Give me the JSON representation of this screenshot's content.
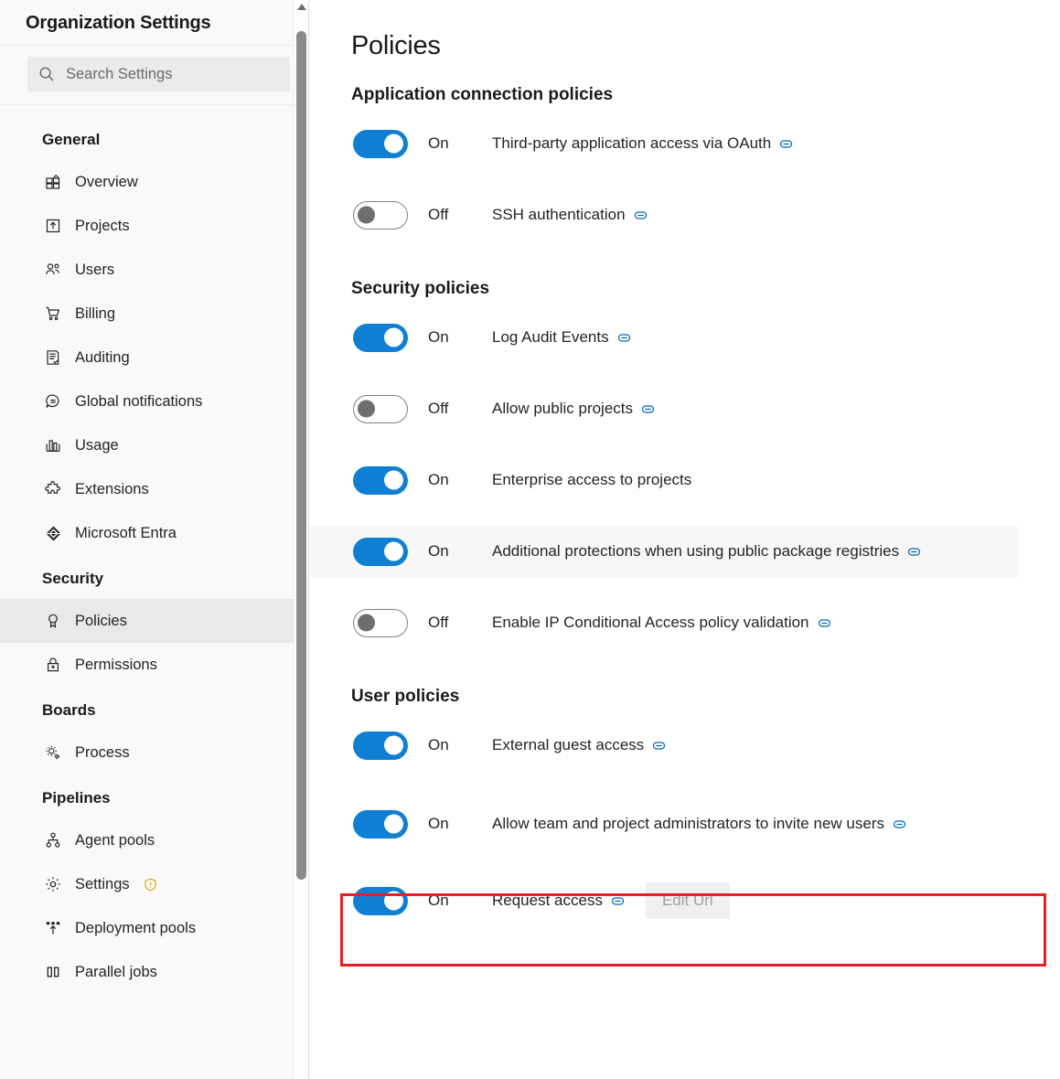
{
  "sidebar": {
    "title": "Organization Settings",
    "search": {
      "placeholder": "Search Settings",
      "value": "",
      "icon": "search-icon"
    },
    "groups": [
      {
        "label": "General",
        "items": [
          {
            "label": "Overview",
            "icon": "overview-icon",
            "active": false
          },
          {
            "label": "Projects",
            "icon": "projects-icon",
            "active": false
          },
          {
            "label": "Users",
            "icon": "users-icon",
            "active": false
          },
          {
            "label": "Billing",
            "icon": "billing-cart-icon",
            "active": false
          },
          {
            "label": "Auditing",
            "icon": "auditing-icon",
            "active": false
          },
          {
            "label": "Global notifications",
            "icon": "notification-bubble-icon",
            "active": false
          },
          {
            "label": "Usage",
            "icon": "usage-chart-icon",
            "active": false
          },
          {
            "label": "Extensions",
            "icon": "extensions-puzzle-icon",
            "active": false
          },
          {
            "label": "Microsoft Entra",
            "icon": "microsoft-entra-icon",
            "active": false
          }
        ]
      },
      {
        "label": "Security",
        "items": [
          {
            "label": "Policies",
            "icon": "policies-ribbon-icon",
            "active": true
          },
          {
            "label": "Permissions",
            "icon": "lock-icon",
            "active": false
          }
        ]
      },
      {
        "label": "Boards",
        "items": [
          {
            "label": "Process",
            "icon": "process-gears-icon",
            "active": false
          }
        ]
      },
      {
        "label": "Pipelines",
        "items": [
          {
            "label": "Agent pools",
            "icon": "agent-pools-icon",
            "active": false
          },
          {
            "label": "Settings",
            "icon": "gear-icon",
            "active": false,
            "badge": "warning-shield-icon"
          },
          {
            "label": "Deployment pools",
            "icon": "deployment-pools-icon",
            "active": false
          },
          {
            "label": "Parallel jobs",
            "icon": "parallel-jobs-icon",
            "active": false
          }
        ]
      }
    ]
  },
  "main": {
    "title": "Policies",
    "sections": [
      {
        "heading": "Application connection policies",
        "policies": [
          {
            "state": "On",
            "on": true,
            "label": "Third-party application access via OAuth",
            "info": true,
            "hovered": false
          },
          {
            "state": "Off",
            "on": false,
            "label": "SSH authentication",
            "info": true,
            "hovered": false
          }
        ]
      },
      {
        "heading": "Security policies",
        "policies": [
          {
            "state": "On",
            "on": true,
            "label": "Log Audit Events",
            "info": true,
            "hovered": false
          },
          {
            "state": "Off",
            "on": false,
            "label": "Allow public projects",
            "info": true,
            "hovered": false
          },
          {
            "state": "On",
            "on": true,
            "label": "Enterprise access to projects",
            "info": false,
            "hovered": false
          },
          {
            "state": "On",
            "on": true,
            "label": "Additional protections when using public package registries",
            "info": true,
            "hovered": true
          },
          {
            "state": "Off",
            "on": false,
            "label": "Enable IP Conditional Access policy validation",
            "info": true,
            "hovered": false
          }
        ]
      },
      {
        "heading": "User policies",
        "policies": [
          {
            "state": "On",
            "on": true,
            "label": "External guest access",
            "info": true,
            "hovered": false
          },
          {
            "state": "On",
            "on": true,
            "label": "Allow team and project administrators to invite new users",
            "info": true,
            "hovered": false,
            "highlighted": true
          },
          {
            "state": "On",
            "on": true,
            "label": "Request access",
            "info": true,
            "hovered": false,
            "button": "Edit Url"
          }
        ]
      }
    ]
  },
  "colors": {
    "toggle_on": "#0f7fd4",
    "toggle_off_border": "#808080",
    "info_icon": "#0067b8",
    "highlight_outline": "#ec1c24",
    "sidebar_bg": "#faf9f8",
    "active_item_bg": "#e9e9e9",
    "warning_badge": "#d8a400"
  }
}
